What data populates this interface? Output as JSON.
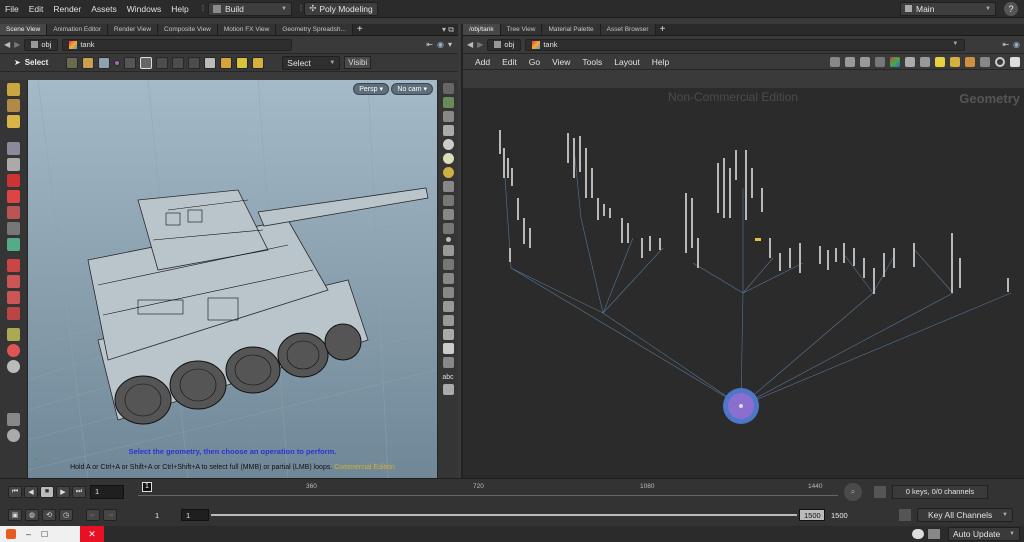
{
  "menubar": {
    "items": [
      "File",
      "Edit",
      "Render",
      "Assets",
      "Windows",
      "Help"
    ],
    "desktop": "Build",
    "shelf": "Poly Modeling",
    "session": "Main"
  },
  "left_pane": {
    "tabs": [
      "Scene View",
      "Animation Editor",
      "Render View",
      "Composite View",
      "Motion FX View",
      "Geometry Spreadsh..."
    ],
    "path": [
      "obj",
      "tank"
    ],
    "toolbar": {
      "mode_label": "Select",
      "select_combo": "Select",
      "visibility_label": "Visibi"
    },
    "viewport": {
      "persp": "Persp",
      "cam": "No cam",
      "hint_primary": "Select the geometry, then choose an operation to perform.",
      "hint_secondary": "Hold A or Ctrl+A or Shift+A or Ctrl+Shift+A to select full (MMB) or partial (LMB) loops.",
      "watermark": "Commercial Edition"
    },
    "side_label": "abc"
  },
  "right_pane": {
    "tabs": [
      "/obj/tank",
      "Tree View",
      "Material Palette",
      "Asset Browser"
    ],
    "path": [
      "obj",
      "tank"
    ],
    "menu": [
      "Add",
      "Edit",
      "Go",
      "View",
      "Tools",
      "Layout",
      "Help"
    ],
    "watermark": "Non-Commercial Edition",
    "context_label": "Geometry"
  },
  "timeline": {
    "current_frame": "1",
    "marker_frame": "1",
    "ticks": [
      "360",
      "720",
      "1080",
      "1440"
    ],
    "start_frame": "1",
    "range_start": "1",
    "range_end": "1500",
    "end_frame": "1500",
    "keys_status": "0 keys, 0/0 channels",
    "key_all": "Key All Channels",
    "auto_update": "Auto Update"
  },
  "colors": {
    "viewport_top": "#9fb4c2",
    "viewport_bottom": "#6f8797",
    "network_bg": "#2b2b2b",
    "accent_node": "#7b6fc9",
    "hint_blue": "#2a34d8",
    "watermark_yellow": "#d6b02a"
  }
}
